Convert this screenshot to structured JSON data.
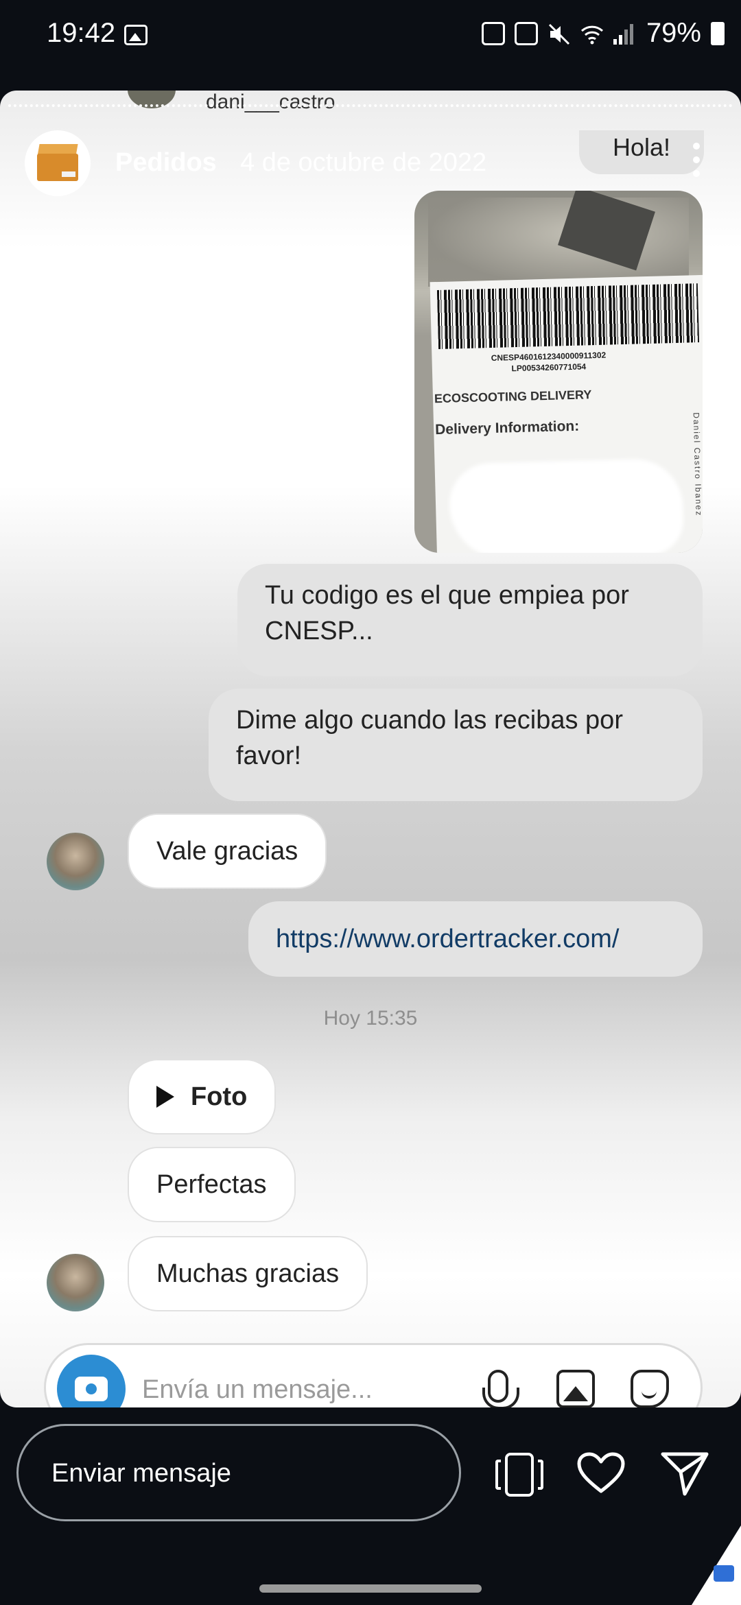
{
  "status_bar": {
    "time": "19:42",
    "battery": "79%",
    "icons": [
      "gallery-icon",
      "upload-icon",
      "nfc-icon",
      "mute-icon",
      "wifi-icon",
      "signal-icon",
      "battery-icon"
    ]
  },
  "story": {
    "header_username": "dani___castro",
    "profile_name": "Pedidos",
    "profile_date": "4 de octubre de 2022"
  },
  "chat": {
    "top_message": "Hola!",
    "photo": {
      "code_line_1": "CNESP4601612340000911302",
      "code_line_2": "LP00534260771054",
      "company": "ECOSCOOTING DELIVERY",
      "section": "Delivery Information:",
      "side_name": "Daniel Castro Ibanez"
    },
    "messages": [
      {
        "direction": "out",
        "text": "Tu codigo es el que empiea por CNESP..."
      },
      {
        "direction": "out",
        "text": "Dime algo cuando las recibas por favor!"
      },
      {
        "direction": "in",
        "text": "Vale gracias"
      },
      {
        "direction": "out",
        "text": "https://www.ordertracker.com/"
      },
      {
        "direction": "in",
        "text": "Foto"
      },
      {
        "direction": "in",
        "text": "Perfectas"
      },
      {
        "direction": "in",
        "text": "Muchas gracias"
      }
    ],
    "timestamp": "Hoy 15:35",
    "composer_placeholder": "Envía un mensaje..."
  },
  "reply_bar": {
    "placeholder": "Enviar mensaje"
  },
  "colors": {
    "background": "#0b0e14",
    "link": "#123c66",
    "camera_button": "#2c8dd3"
  }
}
